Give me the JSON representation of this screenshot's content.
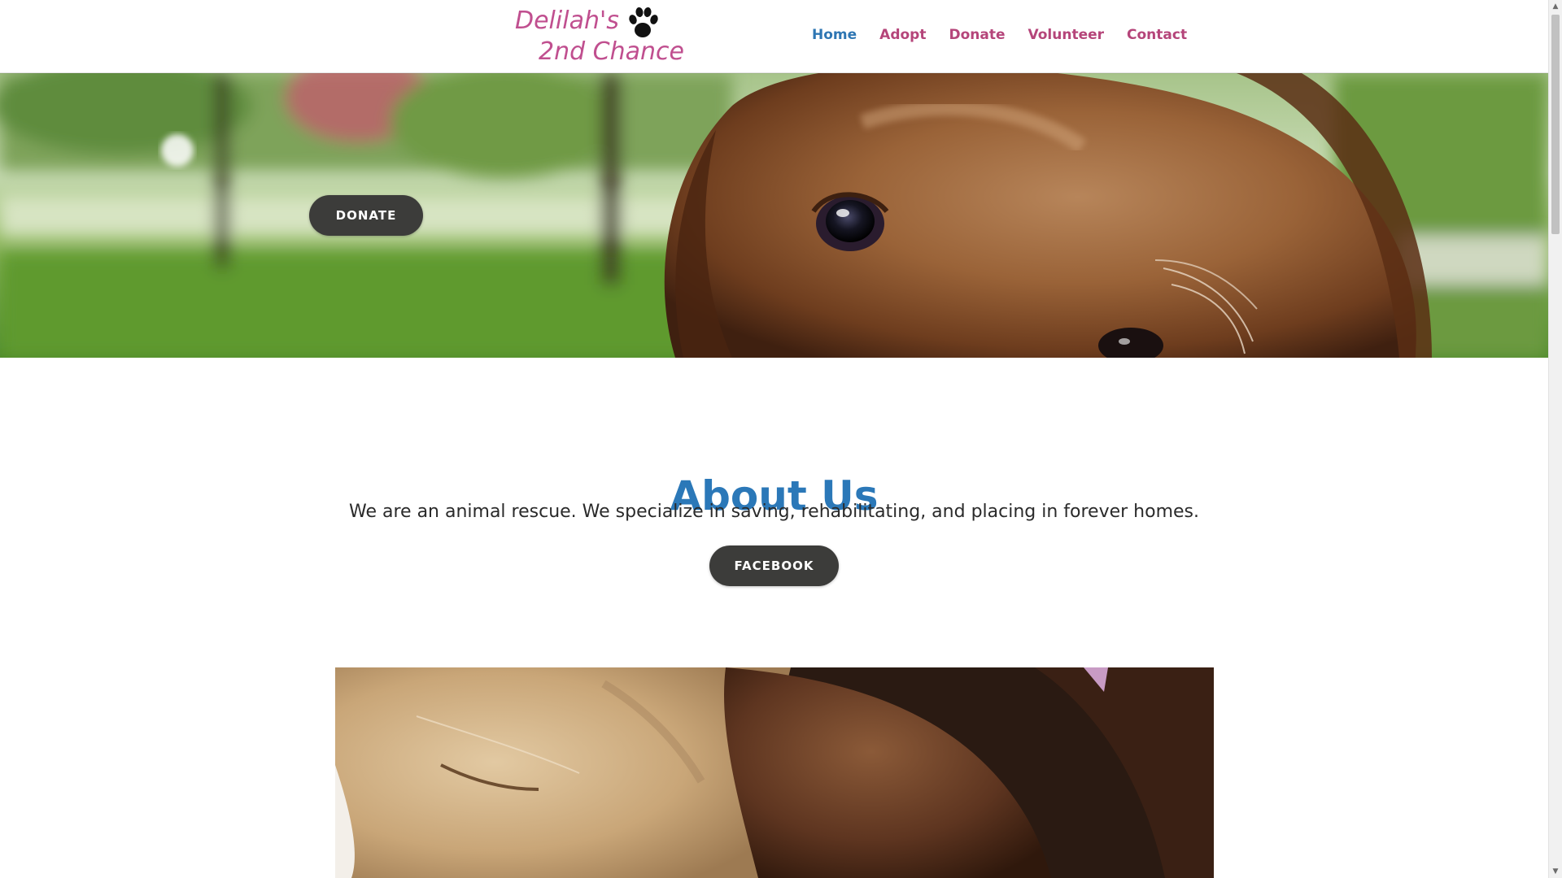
{
  "site": {
    "logo_line1": "Delilah's",
    "logo_line2": "2nd Chance",
    "logo_color": "#c04f8f"
  },
  "nav": {
    "items": [
      {
        "label": "Home",
        "active": true
      },
      {
        "label": "Adopt",
        "active": false
      },
      {
        "label": "Donate",
        "active": false
      },
      {
        "label": "Volunteer",
        "active": false
      },
      {
        "label": "Contact",
        "active": false
      }
    ],
    "active_color": "#2e76b3",
    "link_color": "#b5457a"
  },
  "hero": {
    "button_label": "DONATE",
    "image_subject": "close-up of a golden retriever face in a park"
  },
  "about": {
    "title": "About Us",
    "text": "We are an animal rescue. We specialize in saving, rehabilitating, and placing in forever homes.",
    "button_label": "FACEBOOK",
    "title_color": "#2b78b8"
  },
  "bottom_photo": {
    "image_subject": "two puppies sleeping together"
  },
  "icons": {
    "logo_icon": "paw-print-icon",
    "scroll_up": "chevron-up-icon",
    "scroll_down": "chevron-down-icon"
  },
  "button_color": "#3c3c3a"
}
